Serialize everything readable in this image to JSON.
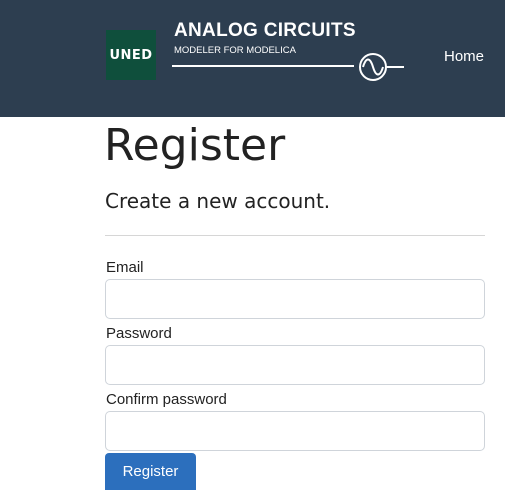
{
  "navbar": {
    "logo_text": "UNED",
    "brand_title": "ANALOG CIRCUITS",
    "brand_subtitle": "MODELER FOR MODELICA",
    "home_link": "Home",
    "background_color": "#2d3e50",
    "logo_color": "#0f4f3c"
  },
  "page": {
    "title": "Register",
    "subtitle": "Create a new account."
  },
  "form": {
    "email_label": "Email",
    "email_value": "",
    "password_label": "Password",
    "password_value": "",
    "confirm_label": "Confirm password",
    "confirm_value": "",
    "submit_label": "Register",
    "submit_color": "#2c6fbd"
  }
}
